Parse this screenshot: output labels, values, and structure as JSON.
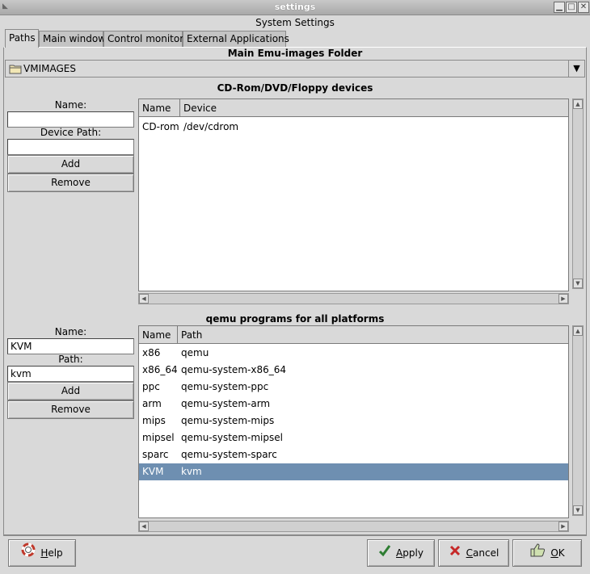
{
  "window": {
    "title": "settings",
    "dialog_title": "System Settings",
    "controls": [
      "minimize-icon",
      "maximize-icon",
      "close-icon"
    ]
  },
  "tabs": [
    {
      "label": "Paths",
      "active": true
    },
    {
      "label": "Main window",
      "active": false
    },
    {
      "label": "Control monitor",
      "active": false
    },
    {
      "label": "External Applications",
      "active": false
    }
  ],
  "emu_folder": {
    "title": "Main Emu-images Folder",
    "value": "VMIMAGES",
    "icon": "folder-icon"
  },
  "devices": {
    "title": "CD-Rom/DVD/Floppy devices",
    "name_label": "Name:",
    "name_value": "",
    "path_label": "Device Path:",
    "path_value": "",
    "add_label": "Add",
    "remove_label": "Remove",
    "columns": [
      "Name",
      "Device"
    ],
    "rows": [
      {
        "name": "CD-rom",
        "device": "/dev/cdrom"
      }
    ]
  },
  "qemu": {
    "title": "qemu programs for all platforms",
    "name_label": "Name:",
    "name_value": "KVM",
    "path_label": "Path:",
    "path_value": "kvm",
    "add_label": "Add",
    "remove_label": "Remove",
    "columns": [
      "Name",
      "Path"
    ],
    "rows": [
      {
        "name": "x86",
        "path": "qemu"
      },
      {
        "name": "x86_64",
        "path": "qemu-system-x86_64"
      },
      {
        "name": "ppc",
        "path": "qemu-system-ppc"
      },
      {
        "name": "arm",
        "path": "qemu-system-arm"
      },
      {
        "name": "mips",
        "path": "qemu-system-mips"
      },
      {
        "name": "mipsel",
        "path": "qemu-system-mipsel"
      },
      {
        "name": "sparc",
        "path": "qemu-system-sparc"
      },
      {
        "name": "KVM",
        "path": "kvm",
        "selected": true
      }
    ]
  },
  "buttons": {
    "help": {
      "prefix": "",
      "accel": "H",
      "rest": "elp"
    },
    "apply": {
      "prefix": "",
      "accel": "A",
      "rest": "pply"
    },
    "cancel": {
      "prefix": "",
      "accel": "C",
      "rest": "ancel"
    },
    "ok": {
      "prefix": "",
      "accel": "O",
      "rest": "K"
    }
  },
  "colors": {
    "selection": "#6e8fb1",
    "window_bg": "#d9d9d9"
  }
}
